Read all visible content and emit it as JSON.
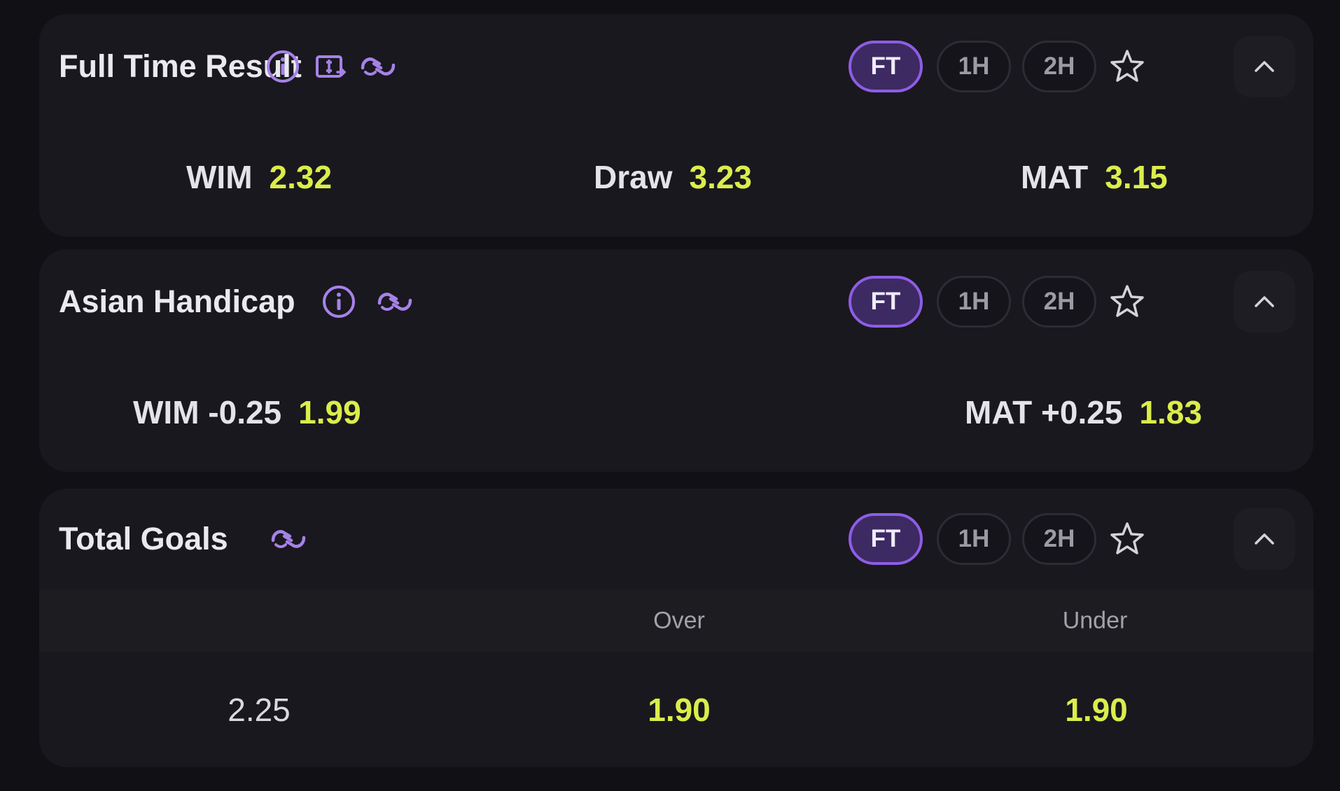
{
  "markets": {
    "full_time_result": {
      "title": "Full Time Result",
      "icons": [
        "info-icon",
        "cash-out-icon",
        "bet-builder-icon"
      ],
      "periods": [
        "FT",
        "1H",
        "2H"
      ],
      "active_period": "FT",
      "outcomes": [
        {
          "label": "WIM",
          "odds": "2.32"
        },
        {
          "label": "Draw",
          "odds": "3.23"
        },
        {
          "label": "MAT",
          "odds": "3.15"
        }
      ]
    },
    "asian_handicap": {
      "title": "Asian Handicap",
      "icons": [
        "info-icon",
        "bet-builder-icon"
      ],
      "periods": [
        "FT",
        "1H",
        "2H"
      ],
      "active_period": "FT",
      "outcomes": [
        {
          "label": "WIM -0.25",
          "odds": "1.99"
        },
        {
          "label": "MAT +0.25",
          "odds": "1.83"
        }
      ]
    },
    "total_goals": {
      "title": "Total Goals",
      "icons": [
        "bet-builder-icon"
      ],
      "periods": [
        "FT",
        "1H",
        "2H"
      ],
      "active_period": "FT",
      "columns": [
        "Over",
        "Under"
      ],
      "rows": [
        {
          "line": "2.25",
          "over": "1.90",
          "under": "1.90"
        }
      ]
    }
  },
  "colors": {
    "background": "#111015",
    "card": "#19181e",
    "accent_purple": "#8e5de6",
    "odds_yellow": "#dbed4b"
  }
}
